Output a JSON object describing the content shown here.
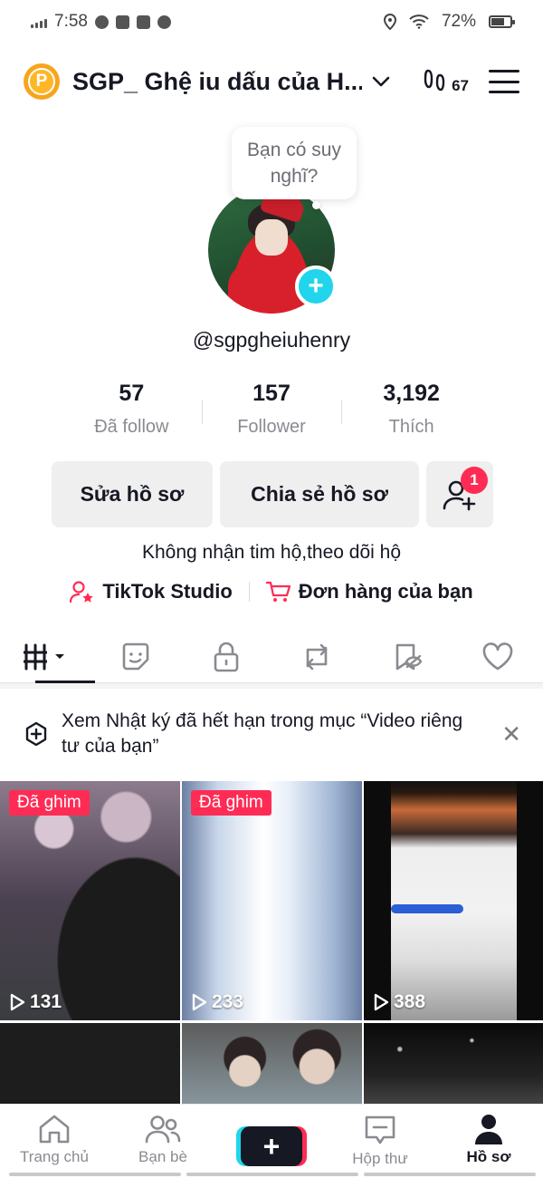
{
  "status_bar": {
    "time": "7:58",
    "battery": "72%",
    "battery_level": 0.72
  },
  "header": {
    "account_name": "SGP_ Ghệ iu dấu của H...",
    "coin_letter": "P",
    "footprint_count": "67"
  },
  "profile": {
    "thought_bubble": "Bạn có suy nghĩ?",
    "handle": "@sgpgheiuhenry",
    "stats": [
      {
        "value": "57",
        "label": "Đã follow"
      },
      {
        "value": "157",
        "label": "Follower"
      },
      {
        "value": "3,192",
        "label": "Thích"
      }
    ],
    "edit_label": "Sửa hồ sơ",
    "share_label": "Chia sẻ hồ sơ",
    "friend_badge": "1",
    "bio": "Không nhận tim hộ,theo dõi hộ",
    "studio_label": "TikTok Studio",
    "orders_label": "Đơn hàng của bạn"
  },
  "notice": {
    "text": "Xem Nhật ký đã hết hạn trong mục “Video riêng tư của bạn”"
  },
  "videos": [
    {
      "pinned": "Đã ghim",
      "views": "131"
    },
    {
      "pinned": "Đã ghim",
      "views": "233"
    },
    {
      "pinned": "",
      "views": "388"
    }
  ],
  "bottom_nav": [
    {
      "label": "Trang chủ"
    },
    {
      "label": "Bạn bè"
    },
    {
      "label": "Hộp thư"
    },
    {
      "label": "Hồ sơ"
    }
  ]
}
